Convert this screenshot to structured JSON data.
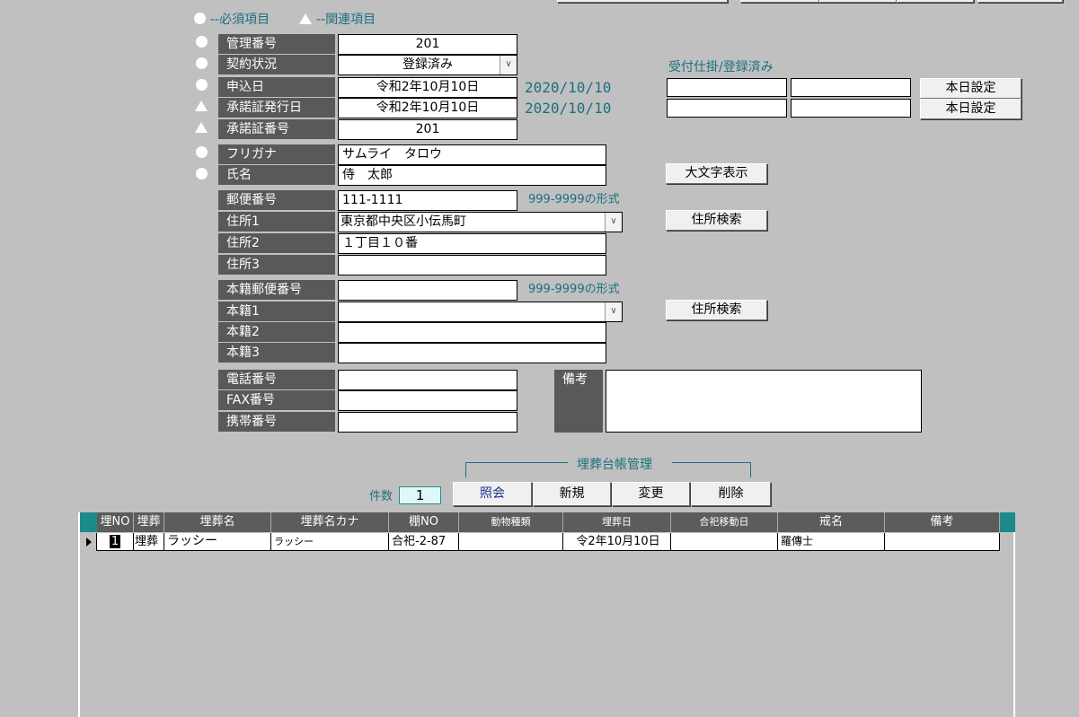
{
  "legend": {
    "required": "--必須項目",
    "related": "--関連項目"
  },
  "fields": {
    "kanri_no": {
      "label": "管理番号",
      "value": "201"
    },
    "keiyaku": {
      "label": "契約状況",
      "value": "登録済み"
    },
    "moshikomi": {
      "label": "申込日",
      "value": "令和2年10月10日",
      "date": "2020/10/10"
    },
    "shodaku_date": {
      "label": "承諾証発行日",
      "value": "令和2年10月10日",
      "date": "2020/10/10"
    },
    "shodaku_no": {
      "label": "承諾証番号",
      "value": "201"
    },
    "furigana": {
      "label": "フリガナ",
      "value": "サムライ　タロウ"
    },
    "shimei": {
      "label": "氏名",
      "value": "侍　太郎"
    },
    "yubin": {
      "label": "郵便番号",
      "value": "111-1111",
      "hint": "999-9999の形式"
    },
    "jusho1": {
      "label": "住所1",
      "value": "東京都中央区小伝馬町"
    },
    "jusho2": {
      "label": "住所2",
      "value": "１丁目１０番"
    },
    "jusho3": {
      "label": "住所3",
      "value": ""
    },
    "honseki_yubin": {
      "label": "本籍郵便番号",
      "value": "",
      "hint": "999-9999の形式"
    },
    "honseki1": {
      "label": "本籍1",
      "value": ""
    },
    "honseki2": {
      "label": "本籍2",
      "value": ""
    },
    "honseki3": {
      "label": "本籍3",
      "value": ""
    },
    "tel": {
      "label": "電話番号",
      "value": ""
    },
    "fax": {
      "label": "FAX番号",
      "value": ""
    },
    "keitai": {
      "label": "携帯番号",
      "value": ""
    },
    "biko": {
      "label": "備考",
      "value": ""
    }
  },
  "uketsuke": {
    "label": "受付仕掛/登録済み",
    "today_button": "本日設定"
  },
  "buttons": {
    "large_text": "大文字表示",
    "address_search": "住所検索"
  },
  "maiso": {
    "group_label": "埋葬台帳管理",
    "count_label": "件数",
    "count": "1",
    "btn_inquiry": "照会",
    "btn_new": "新規",
    "btn_edit": "変更",
    "btn_delete": "削除"
  },
  "grid": {
    "headers": [
      "埋NO",
      "埋葬",
      "埋葬名",
      "埋葬名カナ",
      "棚NO",
      "動物種類",
      "埋葬日",
      "合祀移動日",
      "戒名",
      "備考"
    ],
    "rows": [
      [
        "1",
        "埋葬",
        "ラッシー",
        "ラッシー",
        "合祀-2-87",
        "",
        "令2年10月10日",
        "",
        "羅傳士",
        ""
      ]
    ]
  }
}
